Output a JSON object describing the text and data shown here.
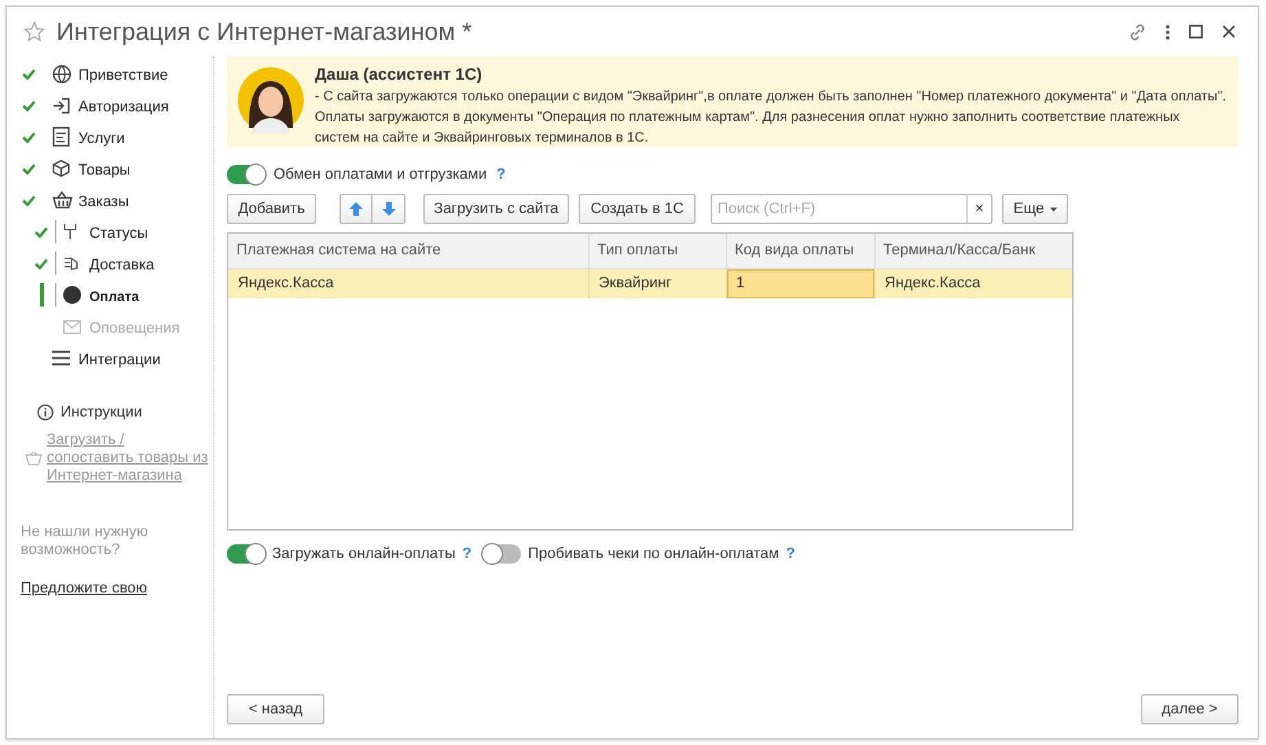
{
  "window": {
    "title": "Интеграция с Интернет-магазином *"
  },
  "sidebar": {
    "steps": [
      {
        "label": "Приветствие",
        "done": true,
        "selected": false,
        "disabled": false
      },
      {
        "label": "Авторизация",
        "done": true,
        "selected": false,
        "disabled": false
      },
      {
        "label": "Услуги",
        "done": true,
        "selected": false,
        "disabled": false
      },
      {
        "label": "Товары",
        "done": true,
        "selected": false,
        "disabled": false
      },
      {
        "label": "Заказы",
        "done": true,
        "selected": false,
        "disabled": false,
        "children": [
          {
            "label": "Статусы",
            "done": true,
            "selected": false,
            "disabled": false
          },
          {
            "label": "Доставка",
            "done": true,
            "selected": false,
            "disabled": false
          },
          {
            "label": "Оплата",
            "done": false,
            "selected": true,
            "disabled": false
          },
          {
            "label": "Оповещения",
            "done": false,
            "selected": false,
            "disabled": true
          }
        ]
      },
      {
        "label": "Интеграции",
        "done": false,
        "selected": false,
        "disabled": false
      }
    ],
    "instructions": "Инструкции",
    "load_link": "Загрузить / сопоставить товары из Интернет-магазина",
    "hint": "Не нашли нужную возможность?",
    "suggest_link": "Предложите свою"
  },
  "assistant": {
    "name": "Даша (ассистент 1С)",
    "text": "- С сайта загружаются только операции с видом \"Эквайринг\",в оплате должен быть заполнен \"Номер платежного документа\" и \"Дата оплаты\". Оплаты загружаются в документы \"Операция по платежным картам\". Для разнесения оплат нужно заполнить соответствие платежных систем на сайте и Эквайринговых терминалов в 1С."
  },
  "exchange_toggle": {
    "label": "Обмен оплатами и отгрузками",
    "on": true,
    "help": "?"
  },
  "toolbar": {
    "add": "Добавить",
    "load": "Загрузить с сайта",
    "create": "Создать в 1С",
    "search": {
      "placeholder": "Поиск (Ctrl+F)",
      "clear": "×"
    },
    "more": "Еще"
  },
  "table": {
    "columns": [
      "Платежная система на сайте",
      "Тип оплаты",
      "Код вида оплаты",
      "Терминал/Касса/Банк"
    ],
    "rows": [
      {
        "selected": true,
        "cells": [
          {
            "text": "Яндекс.Касса",
            "focused": false
          },
          {
            "text": "Эквайринг",
            "focused": false
          },
          {
            "text": "1",
            "focused": true
          },
          {
            "text": "Яндекс.Касса",
            "focused": false
          }
        ]
      }
    ]
  },
  "options": [
    {
      "label": "Загружать онлайн-оплаты",
      "on": true,
      "help": "?"
    },
    {
      "label": "Пробивать чеки по онлайн-оплатам",
      "on": false,
      "help": "?"
    }
  ],
  "footer": {
    "back": "< назад",
    "next": "далее >"
  }
}
